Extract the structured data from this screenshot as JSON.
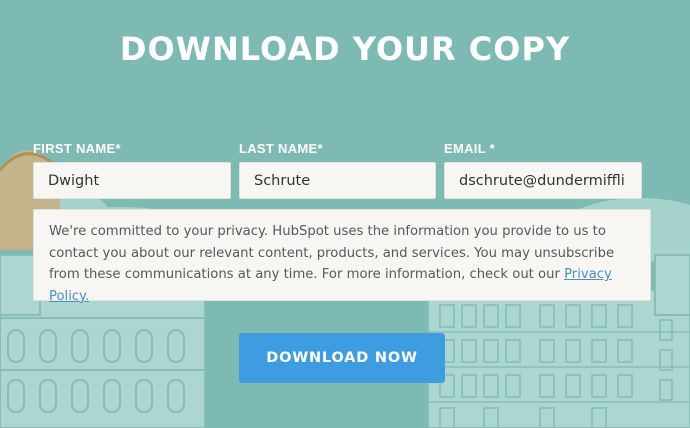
{
  "heading": "DOWNLOAD YOUR COPY",
  "form": {
    "first_name": {
      "label": "FIRST NAME*",
      "value": "Dwight"
    },
    "last_name": {
      "label": "LAST NAME*",
      "value": "Schrute"
    },
    "email": {
      "label": "EMAIL *",
      "value": "dschrute@dundermiffli"
    }
  },
  "privacy": {
    "text": "We're committed to your privacy. HubSpot uses the information you provide to us to contact you about our relevant content, products, and services. You may unsubscribe from these communications at any time. For more information, check out our ",
    "link_label": "Privacy Policy."
  },
  "submit_label": "DOWNLOAD NOW",
  "colors": {
    "background": "#7dbab4",
    "button": "#3d9de0",
    "link": "#4a90c8"
  }
}
